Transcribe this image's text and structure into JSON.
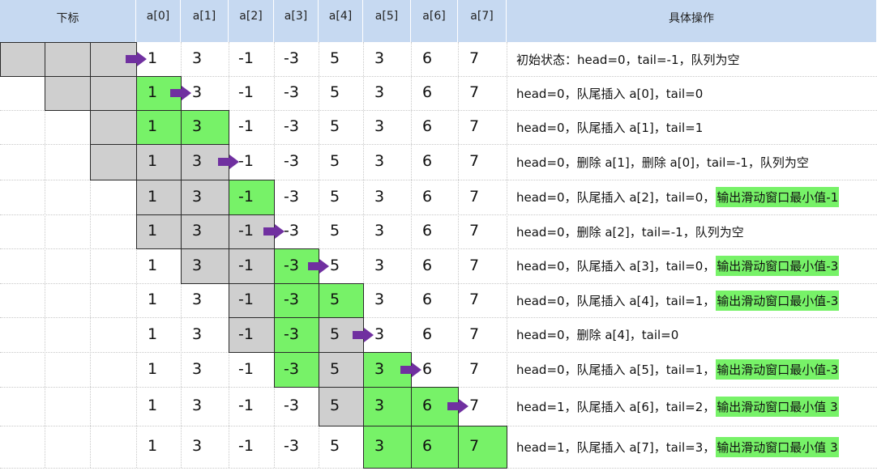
{
  "header": {
    "index_label": "下标",
    "columns": [
      "a[0]",
      "a[1]",
      "a[2]",
      "a[3]",
      "a[4]",
      "a[5]",
      "a[6]",
      "a[7]"
    ],
    "op_label": "具体操作"
  },
  "colors": {
    "header": "#c6d9f1",
    "queue": "#77f268",
    "removed": "#cfcfcf",
    "arrow": "#7030a0"
  },
  "values": [
    "1",
    "3",
    "-1",
    "-3",
    "5",
    "3",
    "6",
    "7"
  ],
  "rows": [
    {
      "op": "初始状态：head=0，tail=-1，队列为空",
      "hl": "",
      "green": [],
      "gray": [
        -3,
        -2,
        -1
      ],
      "arrow": 0
    },
    {
      "op": "head=0，队尾插入 a[0]，tail=0",
      "hl": "",
      "green": [
        0
      ],
      "gray": [
        -2,
        -1
      ],
      "arrow": 1
    },
    {
      "op": "head=0，队尾插入 a[1]，tail=1",
      "hl": "",
      "green": [
        0,
        1
      ],
      "gray": [
        -1
      ],
      "arrow": null
    },
    {
      "op": "head=0，删除 a[1]，删除 a[0]，tail=-1，队列为空",
      "hl": "",
      "green": [],
      "gray": [
        -1,
        0,
        1
      ],
      "arrow": 2
    },
    {
      "op": "head=0，队尾插入 a[2]，tail=0，",
      "hl": "输出滑动窗口最小值-1",
      "green": [
        2
      ],
      "gray": [
        0,
        1
      ],
      "arrow": null
    },
    {
      "op": "head=0，删除 a[2]，tail=-1，队列为空",
      "hl": "",
      "green": [],
      "gray": [
        0,
        1,
        2
      ],
      "arrow": 3
    },
    {
      "op": "head=0，队尾插入 a[3]，tail=0，",
      "hl": "输出滑动窗口最小值-3",
      "green": [
        3
      ],
      "gray": [
        1,
        2
      ],
      "arrow": 4
    },
    {
      "op": "head=0，队尾插入 a[4]，tail=1，",
      "hl": "输出滑动窗口最小值-3",
      "green": [
        3,
        4
      ],
      "gray": [
        2
      ],
      "arrow": null
    },
    {
      "op": "head=0，删除 a[4]，tail=0",
      "hl": "",
      "green": [
        3
      ],
      "gray": [
        2,
        4
      ],
      "arrow": 5
    },
    {
      "op": "head=0，队尾插入 a[5]，tail=1，",
      "hl": "输出滑动窗口最小值-3",
      "green": [
        3,
        5
      ],
      "gray": [
        4
      ],
      "arrow": 6
    },
    {
      "op": "head=1，队尾插入 a[6]，tail=2，",
      "hl": "输出滑动窗口最小值 3",
      "green": [
        5,
        6
      ],
      "gray": [
        4
      ],
      "arrow": 7
    },
    {
      "op": "head=1，队尾插入 a[7]，tail=3，",
      "hl": "输出滑动窗口最小值 3",
      "green": [
        5,
        6,
        7
      ],
      "gray": [],
      "arrow": null
    }
  ]
}
